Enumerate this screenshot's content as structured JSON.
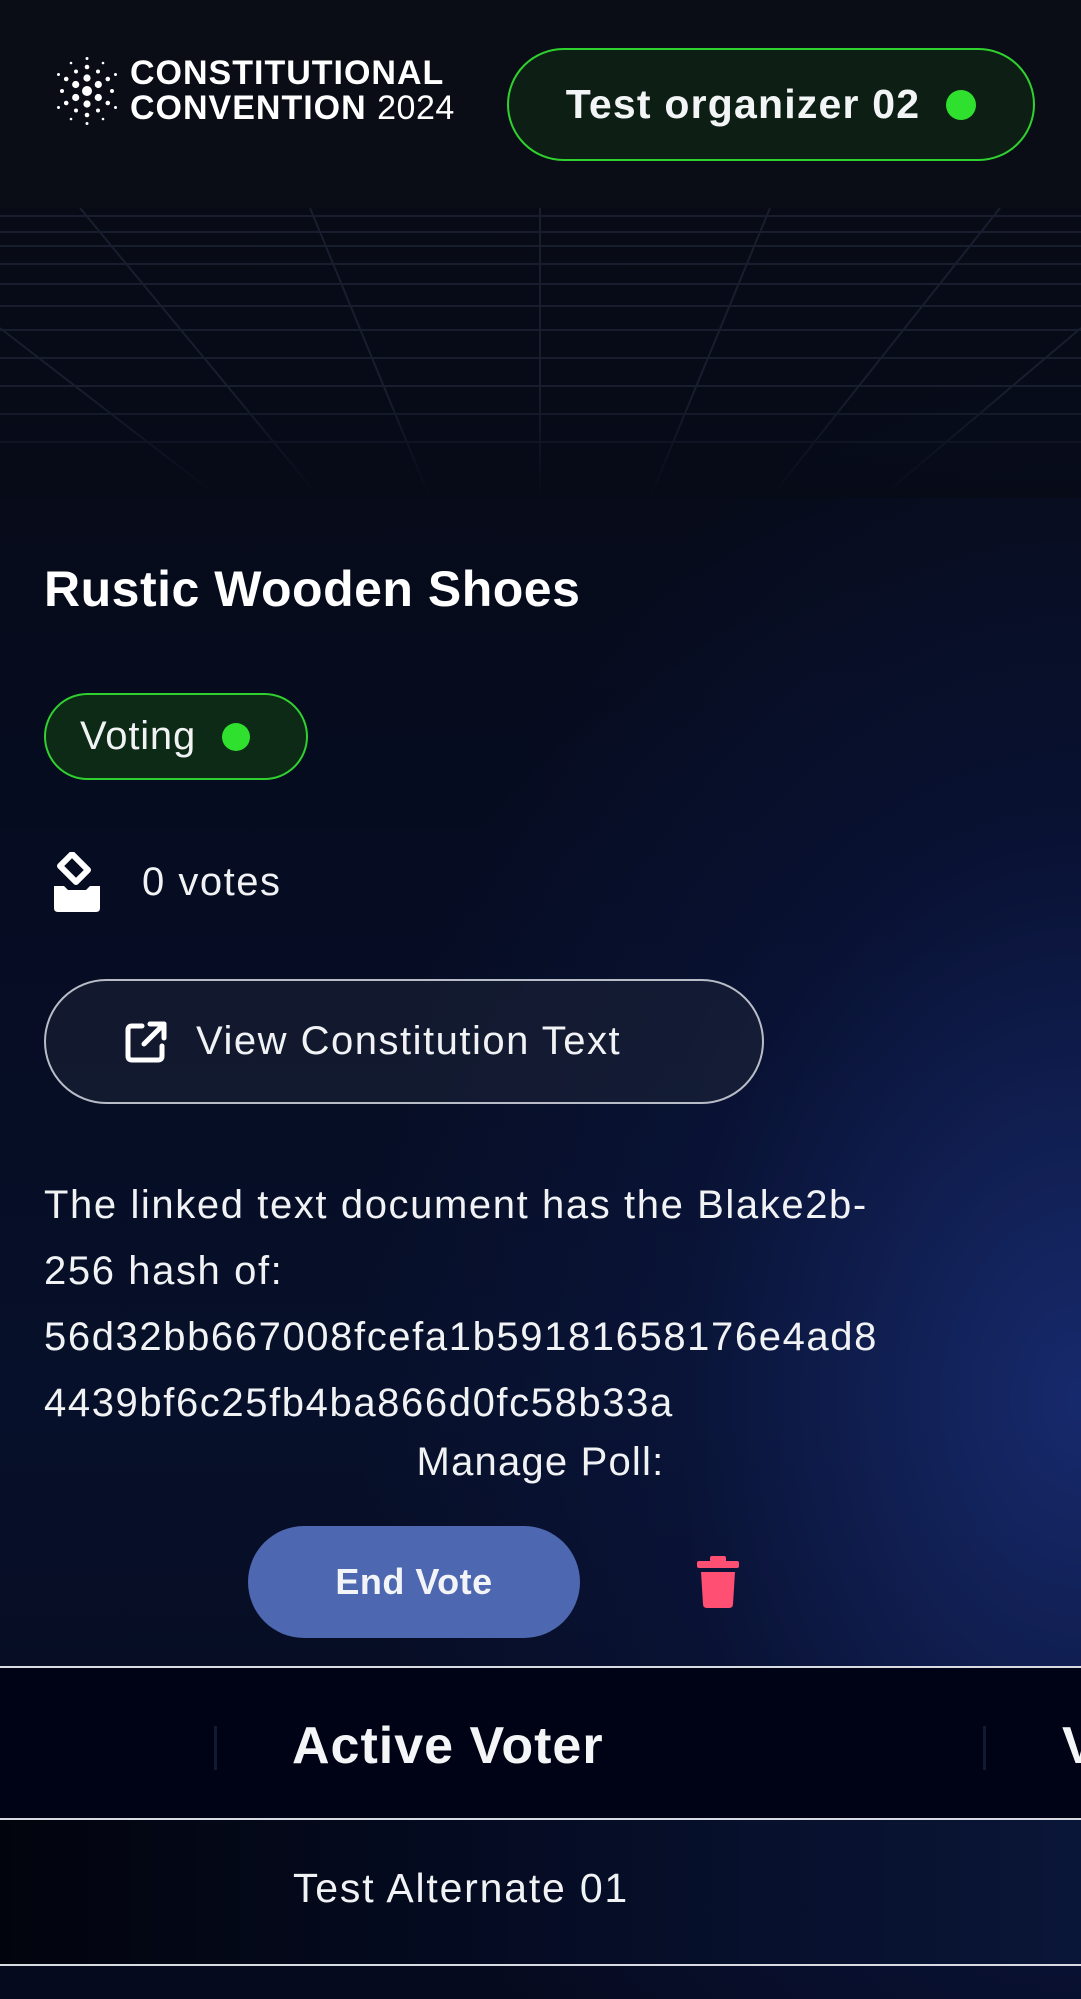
{
  "header": {
    "logo_line1": "CONSTITUTIONAL",
    "logo_line2": "CONVENTION",
    "logo_year": "2024",
    "user_name": "Test organizer 02",
    "status_color": "#2fe02f"
  },
  "poll": {
    "title": "Rustic Wooden Shoes",
    "status": "Voting",
    "votes_text": "0 votes",
    "view_button_label": "View Constitution Text",
    "hash_lines": [
      "The linked text document has the Blake2b-",
      "256 hash of:",
      "56d32bb667008fcefa1b59181658176e4ad8",
      "4439bf6c25fb4ba866d0fc58b33a"
    ],
    "manage_label": "Manage Poll:",
    "end_vote_label": "End Vote"
  },
  "table": {
    "headers": [
      "Active Voter",
      "V"
    ],
    "rows": [
      {
        "active_voter": "Test Alternate 01"
      }
    ]
  },
  "icons": {
    "logo": "cardano-logo-icon",
    "votes": "ballot-box-icon",
    "view": "external-link-icon",
    "delete": "trash-icon"
  },
  "colors": {
    "accent_green": "#2fd12f",
    "primary_button": "#4d67b0",
    "delete_red": "#ff4f72"
  }
}
